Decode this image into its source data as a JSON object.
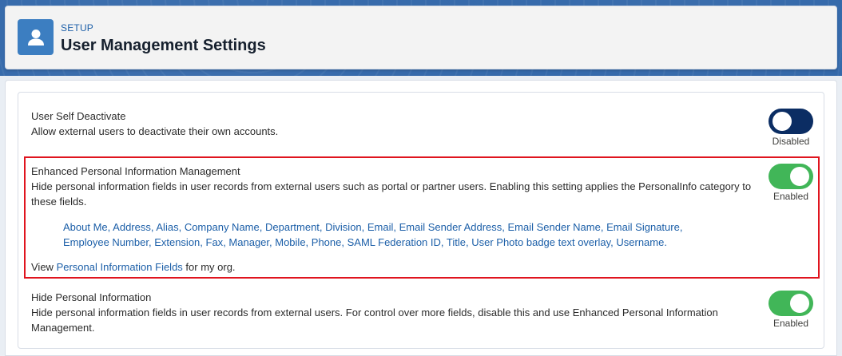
{
  "header": {
    "eyebrow": "SETUP",
    "title": "User Management Settings",
    "icon": "user-icon"
  },
  "settings": [
    {
      "title": "User Self Deactivate",
      "description": "Allow external users to deactivate their own accounts.",
      "state": "off",
      "state_label": "Disabled"
    },
    {
      "title": "Enhanced Personal Information Management",
      "description": "Hide personal information fields in user records from external users such as portal or partner users. Enabling this setting applies the PersonalInfo category to these fields.",
      "state": "on",
      "state_label": "Enabled",
      "fields": [
        "About Me",
        "Address",
        "Alias",
        "Company Name",
        "Department",
        "Division",
        "Email",
        "Email Sender Address",
        "Email Sender Name",
        "Email Signature",
        "Employee Number",
        "Extension",
        "Fax",
        "Manager",
        "Mobile",
        "Phone",
        "SAML Federation ID",
        "Title",
        "User Photo badge text overlay",
        "Username"
      ],
      "view_prefix": "View ",
      "view_link": "Personal Information Fields",
      "view_suffix": " for my org."
    },
    {
      "title": "Hide Personal Information",
      "description": "Hide personal information fields in user records from external users. For control over more fields, disable this and use Enhanced Personal Information Management.",
      "state": "on",
      "state_label": "Enabled"
    }
  ],
  "colors": {
    "brand_blue": "#1c5fa8",
    "toggle_on": "#41b658",
    "toggle_off": "#0b2d63",
    "highlight": "#e0141e"
  }
}
